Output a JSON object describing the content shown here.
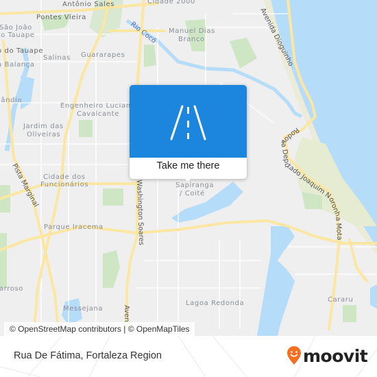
{
  "map": {
    "neighborhoods": [
      {
        "id": "antonio-sales",
        "text": "Antônio Sales"
      },
      {
        "id": "pontes-vieira",
        "text": "Pontes Vieira"
      },
      {
        "id": "sao-joao",
        "text": "São João"
      },
      {
        "id": "do-tauape",
        "text": "do Tauape"
      },
      {
        "id": "o-do-tauape",
        "text": "o do Tauape"
      },
      {
        "id": "a-balanca",
        "text": "a Balança"
      },
      {
        "id": "salinas",
        "text": "Salinas"
      },
      {
        "id": "guararapes",
        "text": "Guararapes"
      },
      {
        "id": "cidade-2000",
        "text": "Cidade 2000"
      },
      {
        "id": "manuel-dias-branco-1",
        "text": "Manuel Dias"
      },
      {
        "id": "manuel-dias-branco-2",
        "text": "Branco"
      },
      {
        "id": "landia",
        "text": "lândia"
      },
      {
        "id": "engenheiro-luciano",
        "text": "Engenheiro Luciano"
      },
      {
        "id": "cavalcante",
        "text": "Cavalcante"
      },
      {
        "id": "jardim-das",
        "text": "Jardim das"
      },
      {
        "id": "oliveiras",
        "text": "Oliveiras"
      },
      {
        "id": "cidade-dos",
        "text": "Cidade dos"
      },
      {
        "id": "funcionarios",
        "text": "Funcionários"
      },
      {
        "id": "sapiranga",
        "text": "Sapiranga"
      },
      {
        "id": "coite",
        "text": "/ Coité"
      },
      {
        "id": "parque-iracema",
        "text": "Parque Iracema"
      },
      {
        "id": "barroso",
        "text": "arroso"
      },
      {
        "id": "messejana",
        "text": "Messejana"
      },
      {
        "id": "lagoa-redonda",
        "text": "Lagoa Redonda"
      },
      {
        "id": "cararu",
        "text": "Cararu"
      }
    ],
    "streets": {
      "rio_coco": "Rio Cocó",
      "avenida_dioguinho": "Avenida Dioguinho",
      "rodovia": "Rodovia Deputado Joaquim Noronha Mota",
      "pista_marginal": "Pista Marginal",
      "washington_soares": "Washington Soares",
      "avenida": "Aven"
    },
    "colors": {
      "land": "#efefef",
      "water": "#b5dcf8",
      "park": "#cfe6c4",
      "dune": "#e6ecd2",
      "road_major": "#fbe6a2",
      "road_minor": "#ffffff"
    }
  },
  "popup": {
    "icon": "road-icon",
    "label": "Take me there",
    "color": "#1c86de"
  },
  "attribution": "© OpenStreetMap contributors | © OpenMapTiles",
  "footer": {
    "title": "Rua De Fátima, Fortaleza Region",
    "brand": "moovit",
    "brand_color": "#f36f21"
  }
}
